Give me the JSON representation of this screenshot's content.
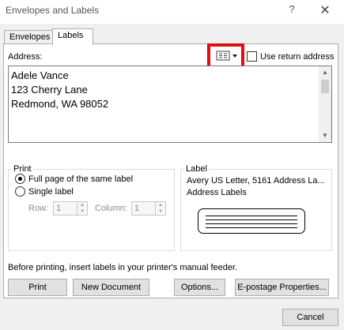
{
  "window": {
    "title": "Envelopes and Labels",
    "help_glyph": "?",
    "close_glyph": "✕"
  },
  "tabs": [
    {
      "label": "Envelopes"
    },
    {
      "label": "Labels"
    }
  ],
  "address": {
    "label": "Address:",
    "lines": [
      "Adele Vance",
      "123 Cherry Lane",
      "Redmond, WA 98052"
    ],
    "use_return_label": "Use return address",
    "use_return_checked": false
  },
  "print": {
    "legend": "Print",
    "full_page_label": "Full page of the same label",
    "single_label": "Single label",
    "selected": "full_page",
    "row_label": "Row:",
    "row_value": "1",
    "column_label": "Column:",
    "column_value": "1"
  },
  "label": {
    "legend": "Label",
    "name": "Avery US Letter, 5161 Address La...",
    "type": "Address Labels"
  },
  "note": "Before printing, insert labels in your printer's manual feeder.",
  "buttons": {
    "print": "Print",
    "new_document": "New Document",
    "options": "Options...",
    "epostage": "E-postage Properties...",
    "cancel": "Cancel"
  },
  "colors": {
    "highlight": "#e01010",
    "background": "#f0f0f0",
    "button": "#e1e1e1"
  },
  "icons": {
    "address_book": "address-book-icon",
    "dropdown": "chevron-down-icon"
  }
}
